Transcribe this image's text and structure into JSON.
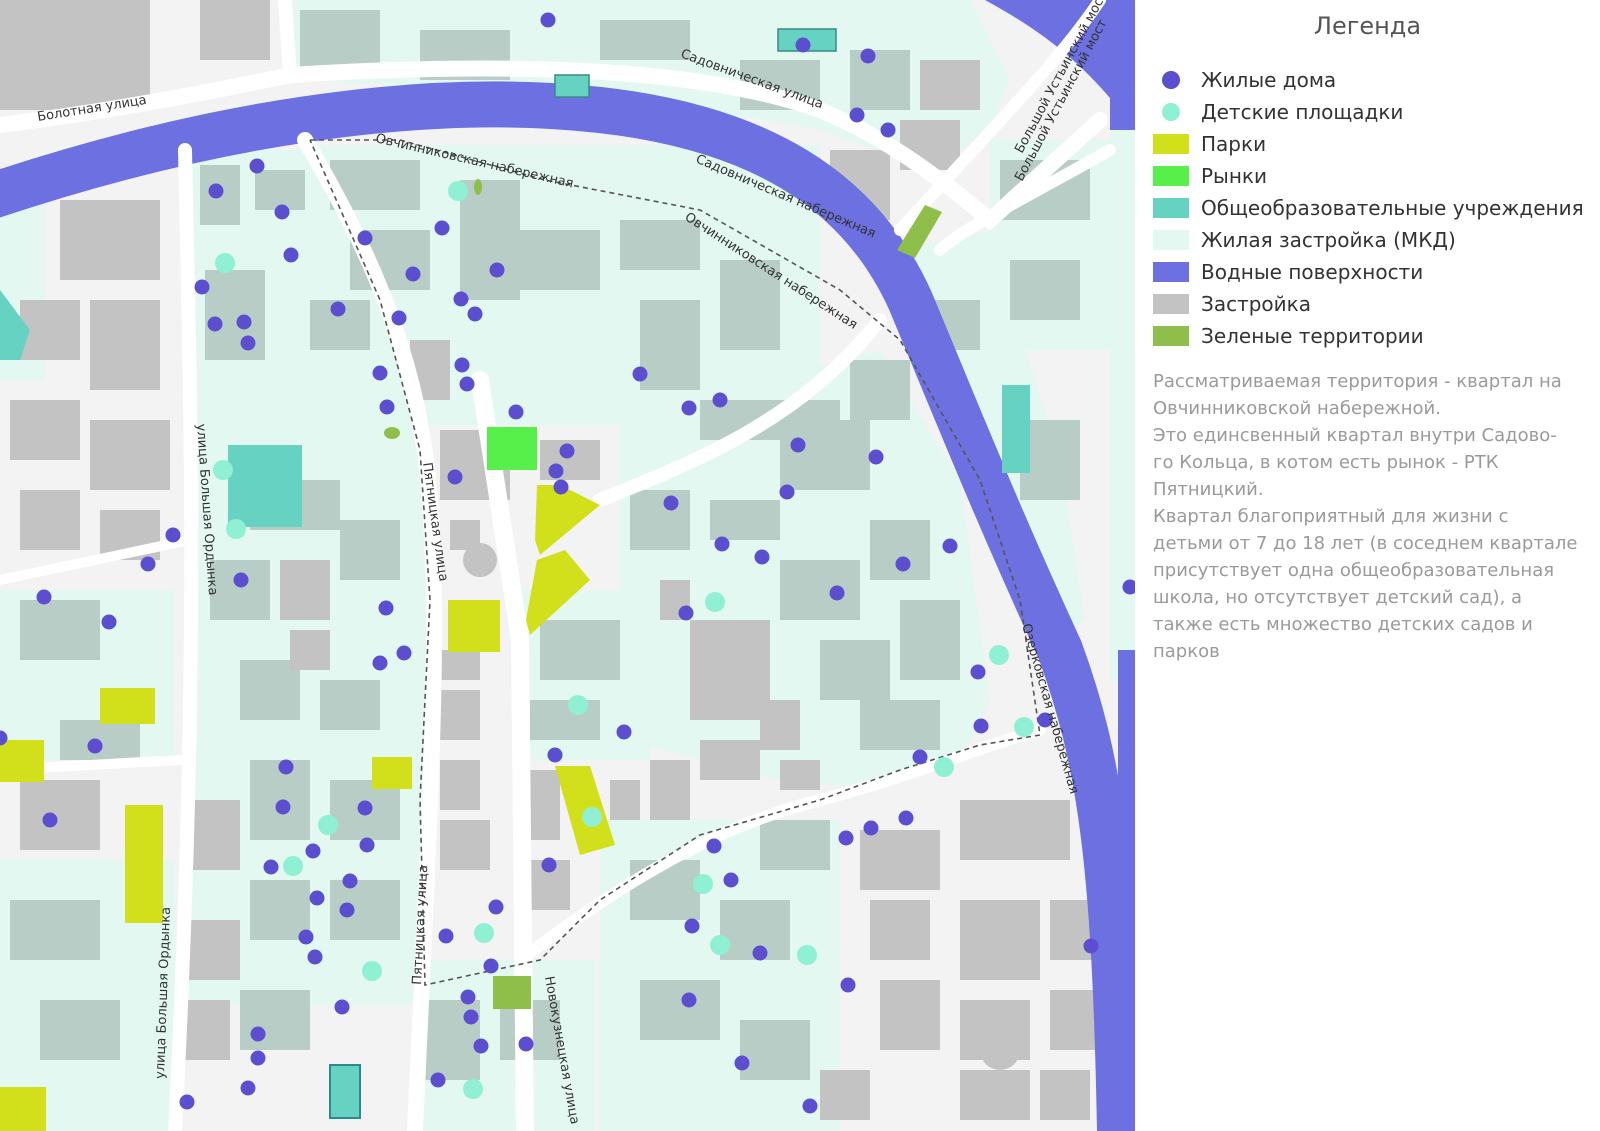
{
  "legend": {
    "title": "Легенда",
    "items": [
      {
        "label": "Жилые дома",
        "kind": "dot",
        "color": "#5b4fcf"
      },
      {
        "label": "Детские площадки",
        "kind": "dot",
        "color": "#8ff0d4"
      },
      {
        "label": "Парки",
        "kind": "box",
        "color": "#d2e01c"
      },
      {
        "label": "Рынки",
        "kind": "box",
        "color": "#57f04a"
      },
      {
        "label": "Общеобразовательные учреждения",
        "kind": "box",
        "color": "#66d3c2"
      },
      {
        "label": "Жилая застройка (МКД)",
        "kind": "box",
        "color": "#e2f8f1"
      },
      {
        "label": "Водные поверхности",
        "kind": "box",
        "color": "#6d70e0"
      },
      {
        "label": "Застройка",
        "kind": "box",
        "color": "#c3c3c3"
      },
      {
        "label": "Зеленые территории",
        "kind": "box",
        "color": "#8fbf4a"
      }
    ],
    "description": [
      "Рассматриваемая территория - квартал на",
      "Овчинниковской набережной.",
      "Это единсвенный квартал внутри Садово-",
      "го Кольца, в котом есть рынок - РТК",
      "Пятницкий.",
      "Квартал благоприятный для жизни с",
      "детьми от 7 до 18 лет (в соседнем квартале",
      "присутствует одна общеобразовательная",
      "школа, но отсутствует детский сад), а",
      "также есть множество детских садов и",
      "парков"
    ]
  },
  "map": {
    "streets": [
      "Болотная улица",
      "Садовническая улица",
      "Садовническая набережная",
      "Овчинниковская набережная",
      "Овчинниковская набережная",
      "Большой Устьинский мост",
      "Большой Устьинский мост",
      "улица Большая Ордынка",
      "улица Большая Ордынка",
      "Пятницкая улица",
      "Пятницкая улица",
      "Новокузнецкая улица",
      "Озерковская набережная"
    ],
    "colors": {
      "water": "#6d70e0",
      "residential": "#e2f8f1",
      "building": "#c3c3c3",
      "building_on_residential": "#b7cdc6",
      "road": "#ffffff",
      "boundary": "#555555"
    }
  }
}
